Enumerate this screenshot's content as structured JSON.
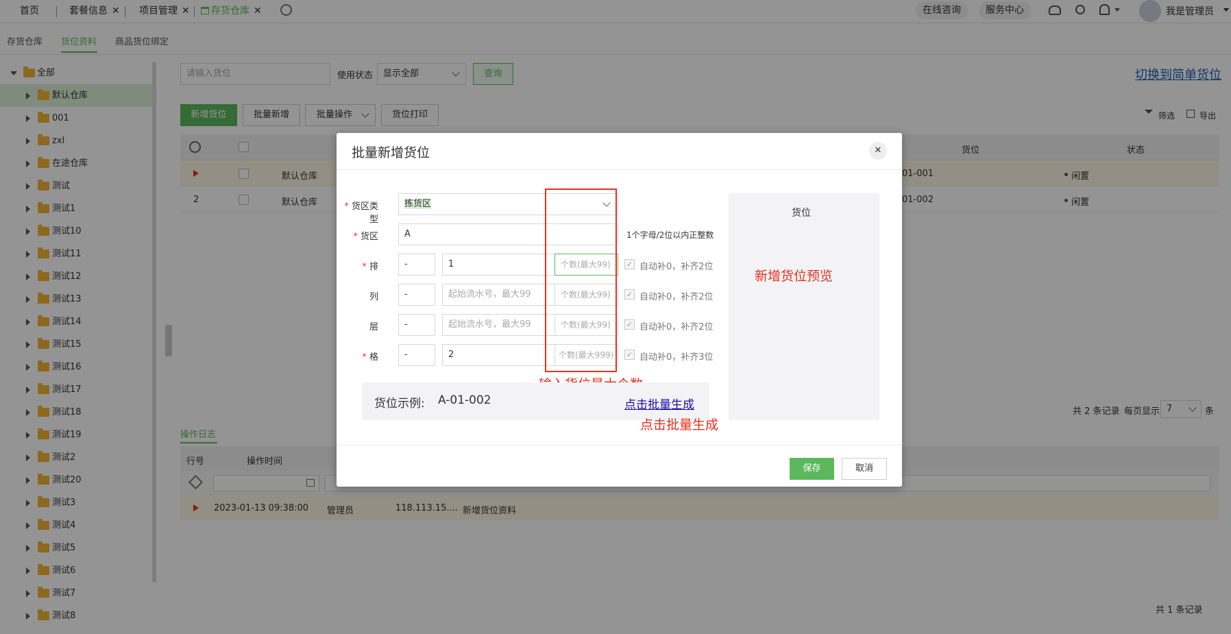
{
  "topbar": {
    "tabs": [
      {
        "label": "首页"
      },
      {
        "label": "套餐信息"
      },
      {
        "label": "项目管理"
      },
      {
        "label": "存货仓库"
      }
    ],
    "close_glyph": "✕",
    "online_consult": "在线咨询",
    "service_center": "服务中心",
    "user_name": "我是管理员",
    "icons": [
      "gear-icon",
      "cloud-download-icon",
      "search-icon",
      "bell-icon",
      "avatar"
    ]
  },
  "subnav": {
    "tabs": [
      "存货仓库",
      "货位资料",
      "商品货位绑定"
    ],
    "active": "货位资料"
  },
  "sidebar": {
    "root": "全部",
    "items": [
      "默认仓库",
      "001",
      "zxl",
      "在途仓库",
      "测试",
      "测试1",
      "测试10",
      "测试11",
      "测试12",
      "测试13",
      "测试14",
      "测试15",
      "测试16",
      "测试17",
      "测试18",
      "测试19",
      "测试2",
      "测试20",
      "测试3",
      "测试4",
      "测试5",
      "测试6",
      "测试7",
      "测试8"
    ],
    "selected": "默认仓库"
  },
  "search": {
    "placeholder": "请输入货位",
    "status_label": "使用状态",
    "status_value": "显示全部",
    "query_button": "查询",
    "switch_link": "切换到简单货位"
  },
  "toolbar": {
    "new": "新增货位",
    "batch_new": "批量新增",
    "batch_ops": "批量操作",
    "print": "货位打印",
    "filter": "筛选",
    "export": "导出"
  },
  "table": {
    "headers": {
      "location": "货位",
      "status": "状态"
    },
    "rows": [
      {
        "no": "",
        "warehouse": "默认仓库",
        "location": "01-001",
        "status": "闲置"
      },
      {
        "no": "2",
        "warehouse": "默认仓库",
        "location": "01-002",
        "status": "闲置"
      }
    ],
    "footer": {
      "total": "共 2 条记录",
      "per_page_label": "每页显示",
      "per_page": "7",
      "unit": "条"
    }
  },
  "log": {
    "tab": "操作日志",
    "headers": {
      "row": "行号",
      "time": "操作时间"
    },
    "row": {
      "time": "2023-01-13 09:38:00",
      "user": "管理员",
      "ip": "118.113.15....",
      "action": "新增货位资料"
    },
    "footer": "共 1 条记录"
  },
  "modal": {
    "title": "批量新增货位",
    "close_glyph": "✕",
    "fields": {
      "zone_type_label": "货区类型",
      "zone_type_value": "拣货区",
      "zone_label": "货区",
      "zone_value": "A",
      "zone_hint": "1个字母/2位以内正整数",
      "row_label": "排",
      "col_label": "列",
      "layer_label": "层",
      "cell_label": "格"
    },
    "rows": [
      {
        "prefix": "-",
        "start": "1",
        "start_ph": "",
        "count_ph": "个数(最大99)",
        "hint": "自动补0，补齐2位"
      },
      {
        "prefix": "-",
        "start": "",
        "start_ph": "起始流水号，最大99",
        "count_ph": "个数(最大99)",
        "hint": "自动补0，补齐2位"
      },
      {
        "prefix": "-",
        "start": "",
        "start_ph": "起始流水号，最大99",
        "count_ph": "个数(最大99)",
        "hint": "自动补0，补齐2位"
      },
      {
        "prefix": "-",
        "start": "2",
        "start_ph": "",
        "count_ph": "个数(最大999)",
        "hint": "自动补0，补齐3位"
      }
    ],
    "check_glyph": "✓",
    "example_label": "货位示例:",
    "example_value": "A-01-002",
    "generate_link": "点击批量生成",
    "preview_header": "货位",
    "save": "保存",
    "cancel": "取消"
  },
  "annotations": {
    "max_count": "输入货位最大个数",
    "click_generate": "点击批量生成",
    "preview": "新增货位预览"
  },
  "colors": {
    "accent": "#5cb85c",
    "annotation": "#e8301c",
    "link": "#1a0dab"
  }
}
